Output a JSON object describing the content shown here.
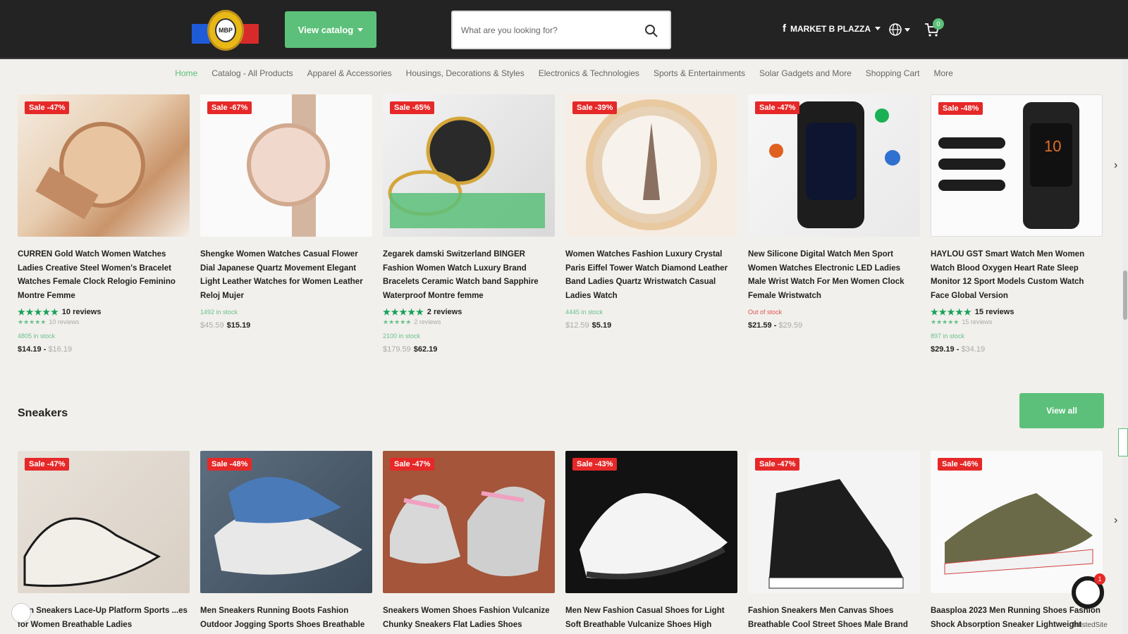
{
  "header": {
    "logo_text": "MBP",
    "catalog_label": "View catalog",
    "search_placeholder": "What are you looking for?",
    "market_label": "MARKET B PLAZZA",
    "cart_count": "0"
  },
  "nav": {
    "items": [
      "Home",
      "Catalog - All Products",
      "Apparel & Accessories",
      "Housings, Decorations & Styles",
      "Electronics & Technologies",
      "Sports & Entertainments",
      "Solar Gadgets and More",
      "Shopping Cart",
      "More"
    ]
  },
  "watches": [
    {
      "sale": "Sale -47%",
      "title": "CURREN Gold Watch Women Watches Ladies Creative Steel Women's Bracelet Watches Female Clock Relogio Feminino Montre Femme",
      "reviews": "10 reviews",
      "reviews_small": "10 reviews",
      "stock": "4805 in stock",
      "price": "$14.19",
      "price_high": "$16.19"
    },
    {
      "sale": "Sale -67%",
      "title": "Shengke Women Watches Casual Flower Dial Japanese Quartz Movement Elegant Light Leather Watches for Women Leather Reloj Mujer",
      "stock": "1492 in stock",
      "old_price": "$45.59",
      "price": "$15.19"
    },
    {
      "sale": "Sale -65%",
      "title": "Zegarek damski Switzerland BINGER Fashion Women Watch Luxury Brand Bracelets Ceramic Watch band Sapphire Waterproof Montre femme",
      "reviews": "2 reviews",
      "reviews_small": "2 reviews",
      "stock": "2100 in stock",
      "old_price": "$179.59",
      "price": "$62.19"
    },
    {
      "sale": "Sale -39%",
      "title": "Women Watches Fashion Luxury Crystal Paris Eiffel Tower Watch Diamond Leather Band Ladies Quartz Wristwatch Casual Ladies Watch",
      "stock": "4445 in stock",
      "old_price": "$12.59",
      "price": "$5.19"
    },
    {
      "sale": "Sale -47%",
      "title": "New Silicone Digital Watch Men Sport Women Watches Electronic LED Ladies Male Wrist Watch For Men Women Clock Female Wristwatch",
      "stock": "Out of stock",
      "price": "$21.59",
      "price_high": "$29.59"
    },
    {
      "sale": "Sale -48%",
      "title": "HAYLOU GST Smart Watch Men Women Watch Blood Oxygen Heart Rate Sleep Monitor 12 Sport Models Custom Watch Face Global Version",
      "reviews": "15 reviews",
      "reviews_small": "15 reviews",
      "stock": "897 in stock",
      "price": "$29.19",
      "price_high": "$34.19"
    }
  ],
  "sneakers_section": {
    "title": "Sneakers",
    "view_all": "View all"
  },
  "sneakers": [
    {
      "sale": "Sale -47%",
      "title": "...en Sneakers Lace-Up Platform Sports ...es for Women Breathable Ladies"
    },
    {
      "sale": "Sale -48%",
      "title": "Men Sneakers Running Boots Fashion Outdoor Jogging Sports Shoes Breathable"
    },
    {
      "sale": "Sale -47%",
      "title": "Sneakers Women Shoes Fashion Vulcanize Chunky Sneakers Flat Ladies Shoes Walking"
    },
    {
      "sale": "Sale -43%",
      "title": "Men New Fashion Casual Shoes for Light Soft Breathable Vulcanize Shoes High"
    },
    {
      "sale": "Sale -47%",
      "title": "Fashion Sneakers Men Canvas Shoes Breathable Cool Street Shoes Male Brand"
    },
    {
      "sale": "Sale -46%",
      "title": "Baasploa 2023 Men Running Shoes Fashion Shock Absorption Sneaker Lightweight"
    }
  ],
  "widgets": {
    "chat_count": "1",
    "trusted": "TrustedSite"
  },
  "colors": {
    "header_bg": "#232323",
    "accent": "#5cc07a",
    "sale": "#e62828",
    "star": "#16a058"
  }
}
